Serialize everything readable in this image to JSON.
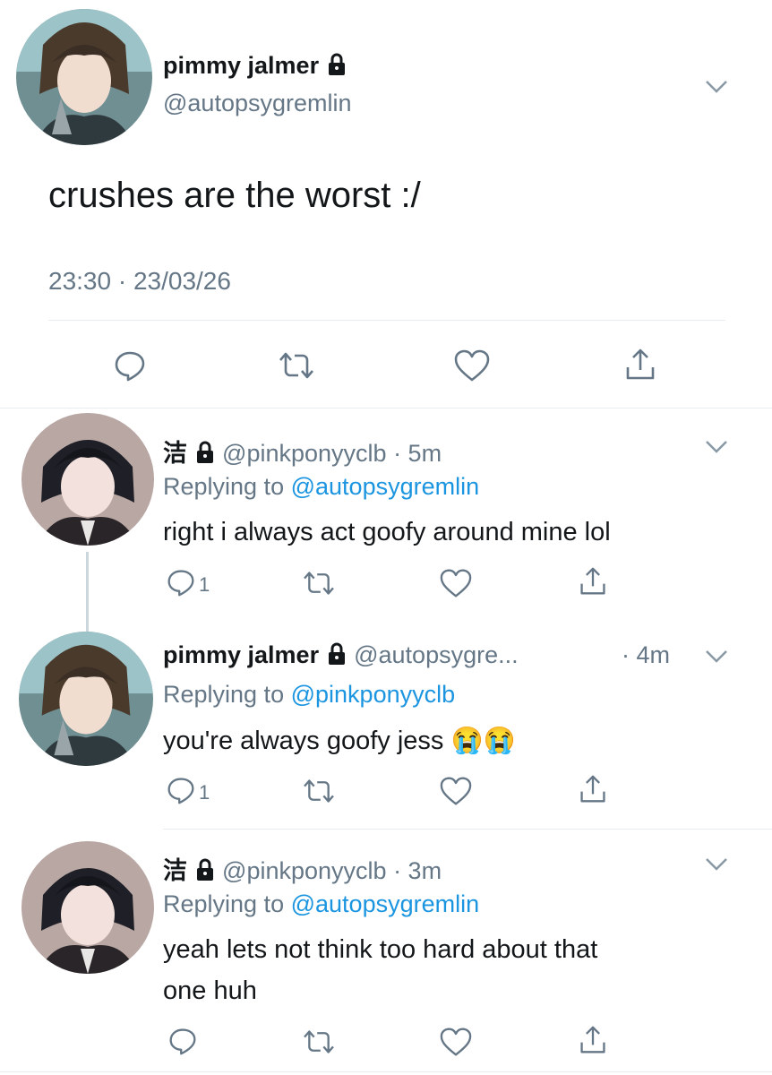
{
  "main_tweet": {
    "display_name": "pimmy jalmer",
    "handle": "@autopsygremlin",
    "text": "crushes are the worst :/",
    "timestamp": "23:30 · 23/03/26"
  },
  "replies": [
    {
      "display_name": "洁",
      "handle": "@pinkponyyclb",
      "time": "· 5m",
      "replying_prefix": "Replying to",
      "replying_to": "@autopsygremlin",
      "text_lines": [
        "right i always act goofy around mine lol"
      ],
      "reply_count": "1"
    },
    {
      "display_name": "pimmy jalmer",
      "handle": "@autopsygre...",
      "time": "· 4m",
      "replying_prefix": "Replying to",
      "replying_to": "@pinkponyyclb",
      "text_lines": [
        "you're always goofy jess"
      ],
      "emoji": "😭😭",
      "reply_count": "1"
    },
    {
      "display_name": "洁",
      "handle": "@pinkponyyclb",
      "time": "· 3m",
      "replying_prefix": "Replying to",
      "replying_to": "@autopsygremlin",
      "text_lines": [
        "yeah lets not think too hard about that",
        "one huh"
      ],
      "reply_count": ""
    }
  ],
  "colors": {
    "link": "#1b95e0",
    "muted": "#657786",
    "divider": "#e6ecf0",
    "thread_line": "#ccd6dd"
  },
  "icons": [
    "reply-icon",
    "retweet-icon",
    "like-icon",
    "share-icon",
    "lock-icon",
    "chevron-down-icon"
  ]
}
